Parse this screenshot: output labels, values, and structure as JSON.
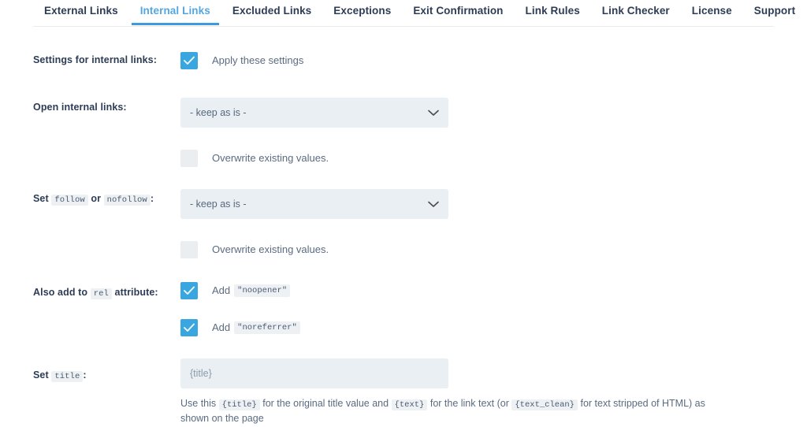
{
  "tabs": [
    {
      "label": "External Links",
      "active": false
    },
    {
      "label": "Internal Links",
      "active": true
    },
    {
      "label": "Excluded Links",
      "active": false
    },
    {
      "label": "Exceptions",
      "active": false
    },
    {
      "label": "Exit Confirmation",
      "active": false
    },
    {
      "label": "Link Rules",
      "active": false
    },
    {
      "label": "Link Checker",
      "active": false
    },
    {
      "label": "License",
      "active": false
    },
    {
      "label": "Support",
      "active": false
    }
  ],
  "colors": {
    "accent": "#3d9ae0",
    "active_tab_text": "#55a7e0",
    "label": "#2d3c55",
    "body_text": "#5a6b80",
    "field_bg": "#eaeff3",
    "checkbox_off": "#ebeef0"
  },
  "settings": {
    "apply": {
      "label": "Settings for internal links:",
      "checkbox_label": "Apply these settings",
      "checked": true
    },
    "open_links": {
      "label": "Open internal links:",
      "selected": "- keep as is -",
      "overwrite_label": "Overwrite existing values.",
      "overwrite_checked": false
    },
    "follow": {
      "label_prefix": "Set",
      "code_follow": "follow",
      "label_or": "or",
      "code_nofollow": "nofollow",
      "label_suffix": ":",
      "selected": "- keep as is -",
      "overwrite_label": "Overwrite existing values.",
      "overwrite_checked": false
    },
    "rel": {
      "label_prefix": "Also add to",
      "code_rel": "rel",
      "label_suffix": "attribute:",
      "noopener": {
        "add_label": "Add",
        "code_value": "\"noopener\"",
        "checked": true
      },
      "noreferrer": {
        "add_label": "Add",
        "code_value": "\"noreferrer\"",
        "checked": true
      }
    },
    "title": {
      "label_prefix": "Set",
      "code_title": "title",
      "label_suffix": ":",
      "value": "{title}",
      "placeholder": "{title}",
      "help": {
        "part1": "Use this",
        "code1": "{title}",
        "part2": "for the original title value and",
        "code2": "{text}",
        "part3": "for the link text (or",
        "code3": "{text_clean}",
        "part4": "for text stripped of HTML) as shown on the page"
      }
    }
  }
}
